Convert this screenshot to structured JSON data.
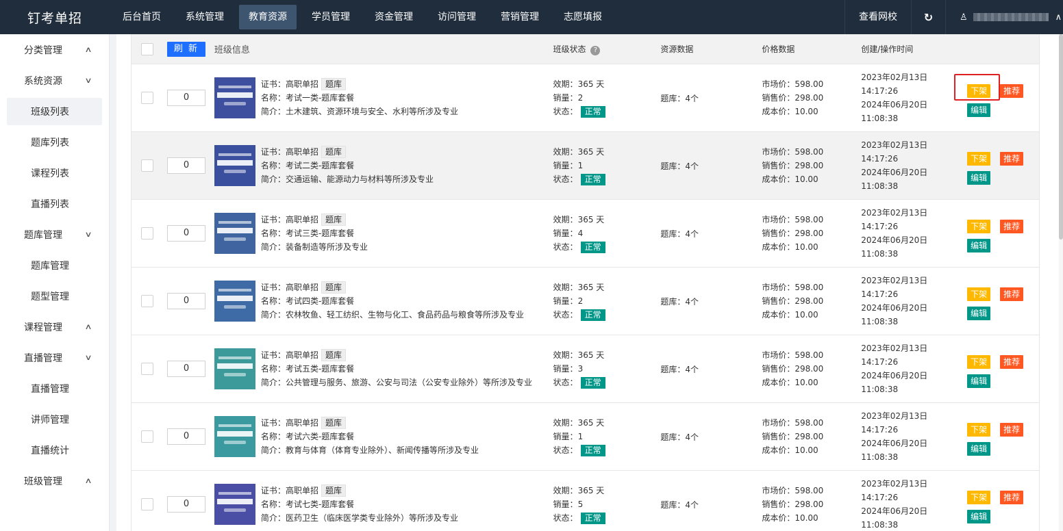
{
  "brand": "钉考单招",
  "nav": [
    "后台首页",
    "系统管理",
    "教育资源",
    "学员管理",
    "资金管理",
    "访问管理",
    "营销管理",
    "志愿填报"
  ],
  "nav_active": 2,
  "top_right": {
    "view_school": "查看网校",
    "refresh": "C",
    "user": "A",
    "collapse": "^"
  },
  "sidebar": [
    {
      "type": "group",
      "label": "分类管理",
      "chevron": "^"
    },
    {
      "type": "group",
      "label": "系统资源",
      "chevron": "v"
    },
    {
      "type": "sub",
      "label": "班级列表",
      "active": true
    },
    {
      "type": "sub",
      "label": "题库列表"
    },
    {
      "type": "sub",
      "label": "课程列表"
    },
    {
      "type": "sub",
      "label": "直播列表"
    },
    {
      "type": "group",
      "label": "题库管理",
      "chevron": "v"
    },
    {
      "type": "sub",
      "label": "题库管理"
    },
    {
      "type": "sub",
      "label": "题型管理"
    },
    {
      "type": "group",
      "label": "课程管理",
      "chevron": "^"
    },
    {
      "type": "group",
      "label": "直播管理",
      "chevron": "v"
    },
    {
      "type": "sub",
      "label": "直播管理"
    },
    {
      "type": "sub",
      "label": "讲师管理"
    },
    {
      "type": "sub",
      "label": "直播统计"
    },
    {
      "type": "group",
      "label": "班级管理",
      "chevron": "^"
    }
  ],
  "table": {
    "refresh_label": "刷 新",
    "headers": {
      "info": "班级信息",
      "status": "班级状态",
      "help": "?",
      "resource": "资源数据",
      "price": "价格数据",
      "time": "创建/操作时间"
    },
    "labels": {
      "cert": "证书：",
      "name": "名称：",
      "intro": "简介：",
      "validity": "效期：",
      "sales": "销量：",
      "state": "状态：",
      "market": "市场价：",
      "sale_price": "销售价：",
      "cost": "成本价："
    },
    "ops": {
      "down": "下架",
      "recommend": "推荐",
      "edit": "编辑"
    },
    "rows": [
      {
        "sort": "0",
        "cert": "高职单招",
        "tag": "题库",
        "name": "考试一类-题库套餐",
        "intro": "土木建筑、资源环境与安全、水利等所涉及专业",
        "validity": "365 天",
        "sales": "2",
        "state": "正常",
        "resource": "题库：4个",
        "market": "598.00",
        "sale": "298.00",
        "cost": "10.00",
        "created_date": "2023年02月13日",
        "created_time": "14:17:26",
        "updated_date": "2024年06月20日",
        "updated_time": "11:08:38",
        "thumb_color": "#3d4f9e",
        "highlight": true
      },
      {
        "sort": "0",
        "cert": "高职单招",
        "tag": "题库",
        "name": "考试二类-题库套餐",
        "intro": "交通运输、能源动力与材料等所涉及专业",
        "validity": "365 天",
        "sales": "1",
        "state": "正常",
        "resource": "题库：4个",
        "market": "598.00",
        "sale": "298.00",
        "cost": "10.00",
        "created_date": "2023年02月13日",
        "created_time": "14:17:26",
        "updated_date": "2024年06月20日",
        "updated_time": "11:08:38",
        "thumb_color": "#3b4f9f"
      },
      {
        "sort": "0",
        "cert": "高职单招",
        "tag": "题库",
        "name": "考试三类-题库套餐",
        "intro": "装备制造等所涉及专业",
        "validity": "365 天",
        "sales": "4",
        "state": "正常",
        "resource": "题库：4个",
        "market": "598.00",
        "sale": "298.00",
        "cost": "10.00",
        "created_date": "2023年02月13日",
        "created_time": "14:17:26",
        "updated_date": "2024年06月20日",
        "updated_time": "11:08:38",
        "thumb_color": "#3f649f"
      },
      {
        "sort": "0",
        "cert": "高职单招",
        "tag": "题库",
        "name": "考试四类-题库套餐",
        "intro": "农林牧鱼、轻工纺织、生物与化工、食品药品与粮食等所涉及专业",
        "validity": "365 天",
        "sales": "2",
        "state": "正常",
        "resource": "题库：4个",
        "market": "598.00",
        "sale": "298.00",
        "cost": "10.00",
        "created_date": "2023年02月13日",
        "created_time": "14:17:26",
        "updated_date": "2024年06月20日",
        "updated_time": "11:08:38",
        "thumb_color": "#3e6aa5"
      },
      {
        "sort": "0",
        "cert": "高职单招",
        "tag": "题库",
        "name": "考试五类-题库套餐",
        "intro": "公共管理与服务、旅游、公安与司法（公安专业除外）等所涉及专业",
        "validity": "365 天",
        "sales": "3",
        "state": "正常",
        "resource": "题库：4个",
        "market": "598.00",
        "sale": "298.00",
        "cost": "10.00",
        "created_date": "2023年02月13日",
        "created_time": "14:17:26",
        "updated_date": "2024年06月20日",
        "updated_time": "11:08:38",
        "thumb_color": "#3c9a9a"
      },
      {
        "sort": "0",
        "cert": "高职单招",
        "tag": "题库",
        "name": "考试六类-题库套餐",
        "intro": "教育与体育（体育专业除外）、新闻传播等所涉及专业",
        "validity": "365 天",
        "sales": "1",
        "state": "正常",
        "resource": "题库：4个",
        "market": "598.00",
        "sale": "298.00",
        "cost": "10.00",
        "created_date": "2023年02月13日",
        "created_time": "14:17:26",
        "updated_date": "2024年06月20日",
        "updated_time": "11:08:38",
        "thumb_color": "#3a9aa0"
      },
      {
        "sort": "0",
        "cert": "高职单招",
        "tag": "题库",
        "name": "考试七类-题库套餐",
        "intro": "医药卫生（临床医学类专业除外）等所涉及专业",
        "validity": "365 天",
        "sales": "5",
        "state": "正常",
        "resource": "题库：4个",
        "market": "598.00",
        "sale": "298.00",
        "cost": "10.00",
        "created_date": "2023年02月13日",
        "created_time": "14:17:26",
        "updated_date": "2024年06月20日",
        "updated_time": "11:08:38",
        "thumb_color": "#4a4fa5"
      }
    ]
  }
}
